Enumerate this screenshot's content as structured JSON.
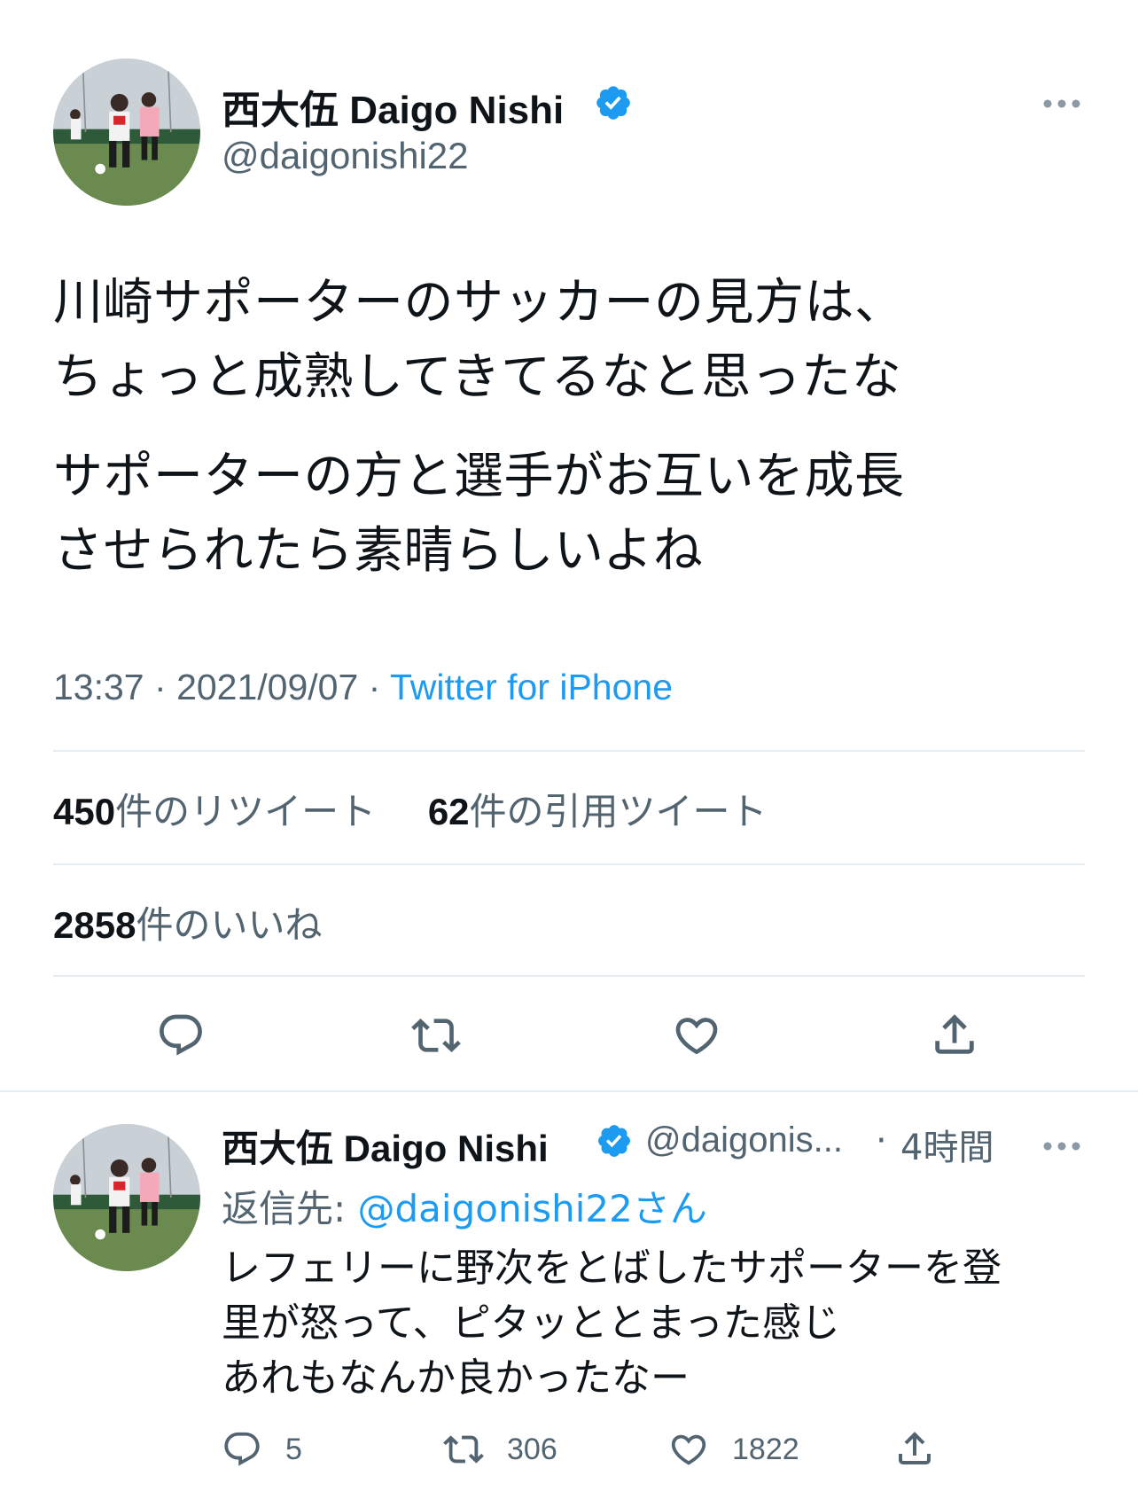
{
  "main_tweet": {
    "author_name": "西大伍 Daigo Nishi",
    "handle": "@daigonishi22",
    "text_lines": [
      "川崎サポーターのサッカーの見方は、",
      "ちょっと成熟してきてるなと思ったな",
      "サポーターの方と選手がお互いを成長",
      "させられたら素晴らしいよね"
    ],
    "time": "13:37",
    "date": "2021/09/07",
    "source": "Twitter for iPhone",
    "retweets_count": "450",
    "retweets_label": "件のリツイート",
    "quotes_count": "62",
    "quotes_label": "件の引用ツイート",
    "likes_count": "2858",
    "likes_label": "件のいいね"
  },
  "reply_tweet": {
    "author_name": "西大伍 Daigo Nishi",
    "handle_truncated": "@daigonis...",
    "time_ago": "4時間",
    "reply_to_label": "返信先:",
    "reply_to_mention": "@daigonishi22さん",
    "text_lines": [
      "レフェリーに野次をとばしたサポーターを登",
      "里が怒って、ピタッととまった感じ",
      "あれもなんか良かったなー"
    ],
    "reply_count": "5",
    "retweet_count": "306",
    "like_count": "1822"
  },
  "colors": {
    "accent": "#1d9bf0",
    "secondary_text": "#536471",
    "primary_text": "#0f1419"
  },
  "icons": [
    "verified-badge-icon",
    "more-icon",
    "reply-icon",
    "retweet-icon",
    "like-icon",
    "share-icon"
  ]
}
